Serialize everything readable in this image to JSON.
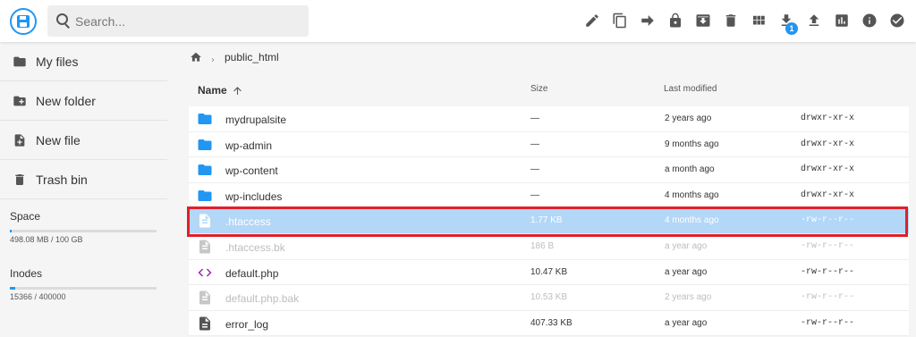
{
  "search": {
    "placeholder": "Search..."
  },
  "toolbar": {
    "actions": [
      "edit-icon",
      "copy-icon",
      "move-icon",
      "lock-icon",
      "archive-icon",
      "delete-icon",
      "grid-icon",
      "download-icon",
      "upload-icon",
      "stats-icon",
      "info-icon",
      "check-icon"
    ],
    "download_badge": "1"
  },
  "sidebar": {
    "items": [
      {
        "label": "My files",
        "icon": "folder-icon"
      },
      {
        "label": "New folder",
        "icon": "folder-plus-icon"
      },
      {
        "label": "New file",
        "icon": "file-plus-icon"
      },
      {
        "label": "Trash bin",
        "icon": "trash-icon"
      }
    ],
    "space": {
      "title": "Space",
      "detail": "498.08 MB / 100 GB",
      "used_fraction": 0.005
    },
    "inodes": {
      "title": "Inodes",
      "detail": "15366 / 400000",
      "used_fraction": 0.038
    }
  },
  "breadcrumb": {
    "path": "public_html"
  },
  "columns": {
    "name": "Name",
    "size": "Size",
    "modified": "Last modified"
  },
  "files": [
    {
      "name": "mydrupalsite",
      "size": "—",
      "modified": "2 years ago",
      "perms": "drwxr-xr-x",
      "type": "folder"
    },
    {
      "name": "wp-admin",
      "size": "—",
      "modified": "9 months ago",
      "perms": "drwxr-xr-x",
      "type": "folder"
    },
    {
      "name": "wp-content",
      "size": "—",
      "modified": "a month ago",
      "perms": "drwxr-xr-x",
      "type": "folder"
    },
    {
      "name": "wp-includes",
      "size": "—",
      "modified": "4 months ago",
      "perms": "drwxr-xr-x",
      "type": "folder"
    },
    {
      "name": ".htaccess",
      "size": "1.77 KB",
      "modified": "4 months ago",
      "perms": "-rw-r--r--",
      "type": "file",
      "selected": true
    },
    {
      "name": ".htaccess.bk",
      "size": "186 B",
      "modified": "a year ago",
      "perms": "-rw-r--r--",
      "type": "file",
      "dim": true
    },
    {
      "name": "default.php",
      "size": "10.47 KB",
      "modified": "a year ago",
      "perms": "-rw-r--r--",
      "type": "code"
    },
    {
      "name": "default.php.bak",
      "size": "10.53 KB",
      "modified": "2 years ago",
      "perms": "-rw-r--r--",
      "type": "file",
      "dim": true
    },
    {
      "name": "error_log",
      "size": "407.33 KB",
      "modified": "a year ago",
      "perms": "-rw-r--r--",
      "type": "doc"
    }
  ],
  "colors": {
    "accent": "#2196f3",
    "selection": "#b3d7f7",
    "highlight": "#e0202a",
    "folder": "#2196f3",
    "code": "#9c27b0"
  }
}
